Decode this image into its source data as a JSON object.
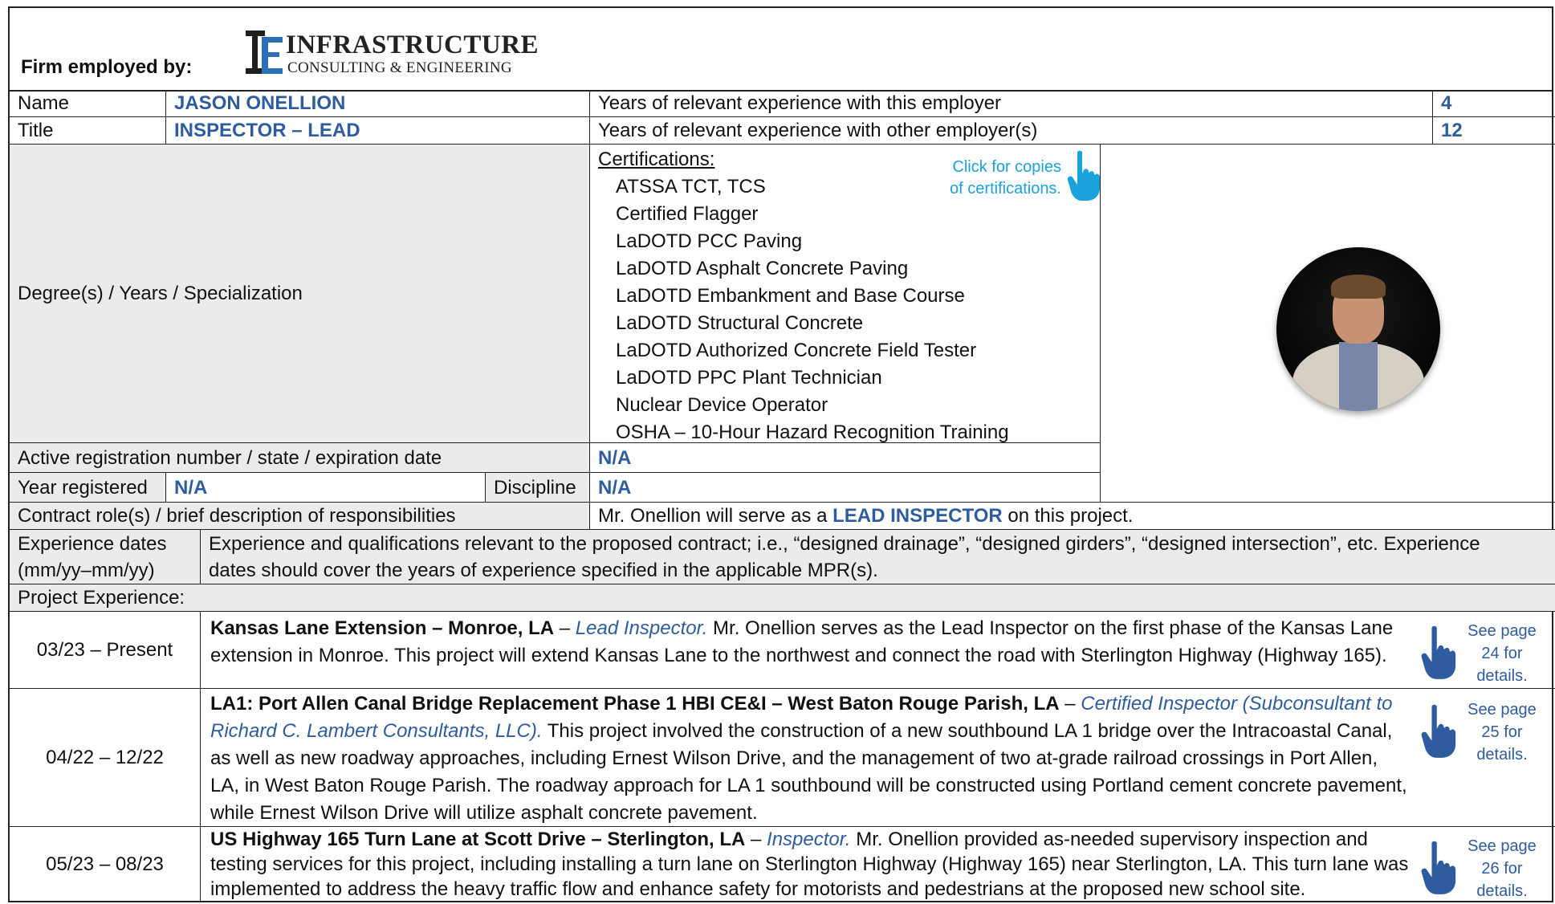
{
  "header": {
    "firm_label": "Firm employed by:",
    "logo_line1": "INFRASTRUCTURE",
    "logo_line2": "CONSULTING & ENGINEERING"
  },
  "rows": {
    "name_label": "Name",
    "name_value": "JASON ONELLION",
    "title_label": "Title",
    "title_value": "INSPECTOR – LEAD",
    "years_this_label": "Years of relevant experience with this employer",
    "years_this_value": "4",
    "years_other_label": "Years of relevant experience with other employer(s)",
    "years_other_value": "12",
    "degree_label": "Degree(s) / Years / Specialization",
    "registration_label": "Active registration number / state / expiration date",
    "registration_value": "N/A",
    "year_registered_label": "Year registered",
    "year_registered_value": "N/A",
    "discipline_label": "Discipline",
    "discipline_value": "N/A",
    "contract_role_label": "Contract role(s) / brief description of responsibilities",
    "contract_role_prefix": "Mr. Onellion will serve as a",
    "contract_role_highlight": "LEAD INSPECTOR",
    "contract_role_suffix": "on this project."
  },
  "certifications": {
    "heading": "Certifications:",
    "items": [
      "ATSSA TCT, TCS",
      "Certified Flagger",
      "LaDOTD PCC Paving",
      "LaDOTD Asphalt Concrete Paving",
      "LaDOTD Embankment and Base Course",
      "LaDOTD Structural Concrete",
      "LaDOTD Authorized Concrete Field Tester",
      "LaDOTD PPC Plant Technician",
      "Nuclear Device Operator",
      "OSHA – 10-Hour Hazard Recognition Training"
    ],
    "click_note_line1": "Click for copies",
    "click_note_line2": "of certifications."
  },
  "experience_header": {
    "dates_label_line1": "Experience dates",
    "dates_label_line2": "(mm/yy–mm/yy)",
    "desc_line1": "Experience and qualifications relevant to the proposed contract; i.e., “designed drainage”, “designed girders”, “designed intersection”, etc.  Experience",
    "desc_line2": "dates should cover the years of experience specified in the applicable MPR(s).",
    "project_experience_label": "Project Experience:"
  },
  "projects": [
    {
      "dates": "03/23 – Present",
      "title": "Kansas Lane Extension – Monroe, LA",
      "sep": " – ",
      "role": "Lead Inspector.",
      "desc": " Mr. Onellion serves as the Lead Inspector on the first phase of the Kansas Lane extension in Monroe. This project will extend Kansas Lane to the northwest and connect the road with Sterlington Highway (Highway 165).",
      "see_line1": "See page",
      "see_line2": "24 for",
      "see_line3": "details."
    },
    {
      "dates": "04/22 – 12/22",
      "title": "LA1: Port Allen Canal Bridge Replacement Phase 1 HBI CE&I – West Baton Rouge Parish, LA",
      "sep": " – ",
      "role": "Certified Inspector (Subconsultant to Richard C. Lambert Consultants, LLC).",
      "desc": " This project involved the construction of a new southbound LA 1 bridge over the Intracoastal Canal, as well as new roadway approaches, including Ernest Wilson Drive, and the management of two at-grade railroad crossings in Port Allen, LA, in West Baton Rouge Parish. The roadway approach for LA 1 southbound will be constructed using Portland cement concrete pavement, while Ernest Wilson Drive will utilize asphalt concrete pavement.",
      "see_line1": "See page",
      "see_line2": "25 for",
      "see_line3": "details."
    },
    {
      "dates": "05/23 – 08/23",
      "title": "US Highway 165 Turn Lane at Scott Drive – Sterlington, LA",
      "sep": " – ",
      "role": "Inspector.",
      "desc": " Mr. Onellion provided as-needed supervisory inspection and testing services for this project, including installing a turn lane on Sterlington Highway (Highway 165) near Sterlington, LA. This turn lane was implemented to address the heavy traffic flow and enhance safety for motorists and pedestrians at the proposed new school site.",
      "see_line1": "See page",
      "see_line2": "26 for",
      "see_line3": "details."
    }
  ],
  "colors": {
    "accent_blue": "#2e5c9e",
    "link_cyan": "#1ba1db",
    "header_gray": "#ebebeb"
  },
  "icons": [
    "ie-logo-icon",
    "pointing-hand-icon"
  ]
}
